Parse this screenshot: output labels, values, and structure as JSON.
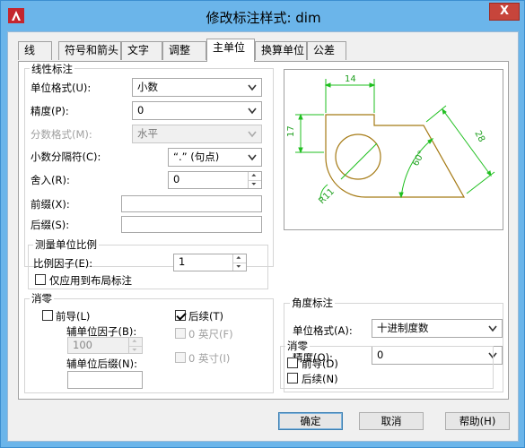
{
  "window": {
    "title": "修改标注样式: dim",
    "close_label": "X"
  },
  "tabs": [
    {
      "label": "线",
      "active": false
    },
    {
      "label": "符号和箭头",
      "active": false
    },
    {
      "label": "文字",
      "active": false
    },
    {
      "label": "调整",
      "active": false
    },
    {
      "label": "主单位",
      "active": true
    },
    {
      "label": "换算单位",
      "active": false
    },
    {
      "label": "公差",
      "active": false
    }
  ],
  "linear": {
    "group_title": "线性标注",
    "unit_format_label": "单位格式(U):",
    "unit_format_value": "小数",
    "precision_label": "精度(P):",
    "precision_value": "0",
    "fraction_format_label": "分数格式(M):",
    "fraction_format_value": "水平",
    "decimal_separator_label": "小数分隔符(C):",
    "decimal_separator_value": "“.” (句点)",
    "round_off_label": "舍入(R):",
    "round_off_value": "0",
    "prefix_label": "前缀(X):",
    "prefix_value": "",
    "suffix_label": "后缀(S):",
    "suffix_value": ""
  },
  "measurement_scale": {
    "group_title": "测量单位比例",
    "scale_factor_label": "比例因子(E):",
    "scale_factor_value": "1",
    "layout_only_label": "仅应用到布局标注",
    "layout_only_checked": false
  },
  "zero_suppression": {
    "group_title": "消零",
    "leading_label": "前导(L)",
    "leading_checked": false,
    "trailing_label": "后续(T)",
    "trailing_checked": true,
    "sub_factor_label": "辅单位因子(B):",
    "sub_factor_value": "100",
    "sub_suffix_label": "辅单位后缀(N):",
    "sub_suffix_value": "",
    "feet_label": "0 英尺(F)",
    "inches_label": "0 英寸(I)"
  },
  "preview": {
    "dim_top": "14",
    "dim_left": "17",
    "dim_slant": "28",
    "dim_angle": "60°",
    "dim_radius": "R11"
  },
  "angular": {
    "group_title": "角度标注",
    "unit_format_label": "单位格式(A):",
    "unit_format_value": "十进制度数",
    "precision_label": "精度(O):",
    "precision_value": "0",
    "zero_group_title": "消零",
    "leading_label": "前导(D)",
    "trailing_label": "后续(N)"
  },
  "buttons": {
    "ok": "确定",
    "cancel": "取消",
    "help": "帮助(H)"
  },
  "colors": {
    "titlebar": "#6bb5ea",
    "close": "#c7453b",
    "preview_shape": "#a57a14",
    "preview_dim": "#1fbf1f"
  }
}
